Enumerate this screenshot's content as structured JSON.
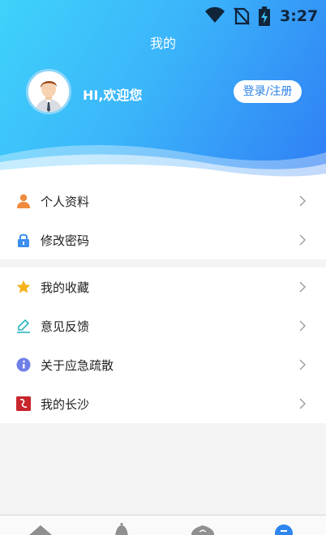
{
  "status_bar": {
    "time": "3:27"
  },
  "header": {
    "title": "我的",
    "greeting": "HI,欢迎您",
    "login_button": "登录/注册"
  },
  "menu": {
    "group1": [
      {
        "label": "个人资料",
        "icon": "user-icon"
      },
      {
        "label": "修改密码",
        "icon": "lock-icon"
      }
    ],
    "group2": [
      {
        "label": "我的收藏",
        "icon": "star-icon"
      },
      {
        "label": "意见反馈",
        "icon": "feedback-pen-icon"
      },
      {
        "label": "关于应急疏散",
        "icon": "info-icon"
      },
      {
        "label": "我的长沙",
        "icon": "changsha-logo-icon"
      }
    ]
  },
  "colors": {
    "header_gradient_start": "#3fd2fb",
    "header_gradient_end": "#2f7df4",
    "login_text": "#2b83e8",
    "user_icon": "#f08a3c",
    "lock_icon": "#3b8ef0",
    "star_icon": "#f6b21b",
    "feedback_icon": "#2bb3c0",
    "info_icon": "#6f7fe8",
    "changsha_icon": "#c8252c"
  }
}
